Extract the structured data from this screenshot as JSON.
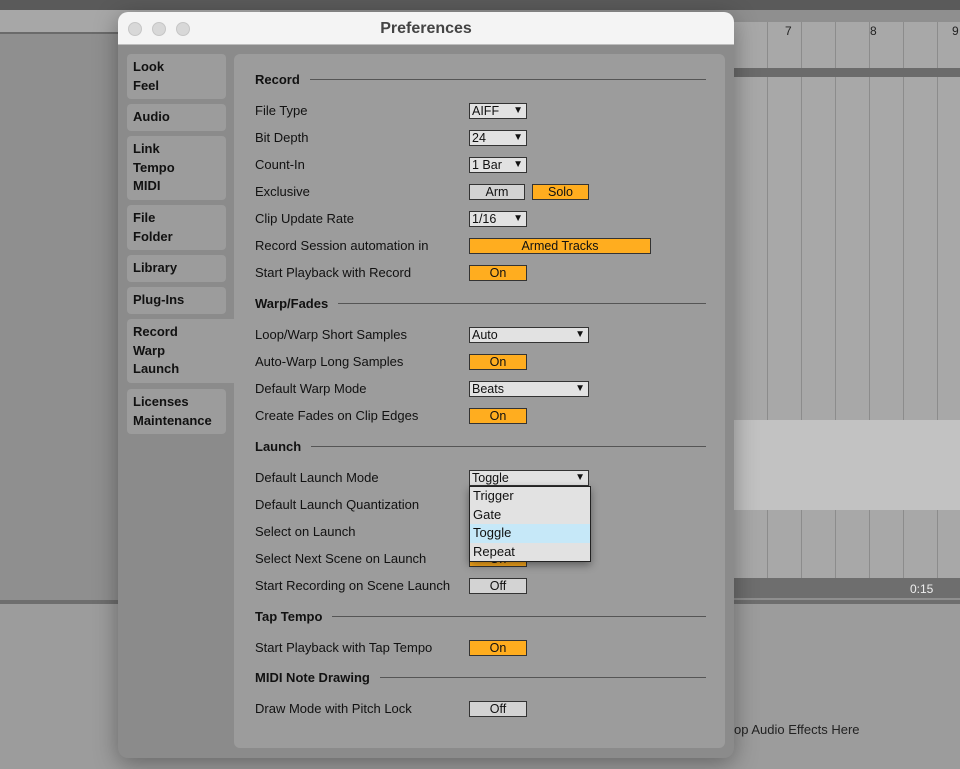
{
  "window": {
    "title": "Preferences"
  },
  "background": {
    "ruler": [
      "7",
      "8",
      "9"
    ],
    "time": "0:15",
    "drop_hint": "op Audio Effects Here"
  },
  "sidebar": {
    "tabs": [
      {
        "lines": [
          "Look",
          "Feel"
        ]
      },
      {
        "lines": [
          "Audio"
        ]
      },
      {
        "lines": [
          "Link",
          "Tempo",
          "MIDI"
        ]
      },
      {
        "lines": [
          "File",
          "Folder"
        ]
      },
      {
        "lines": [
          "Library"
        ]
      },
      {
        "lines": [
          "Plug-Ins"
        ]
      },
      {
        "lines": [
          "Record",
          "Warp",
          "Launch"
        ],
        "active": true
      },
      {
        "lines": [
          "Licenses",
          "Maintenance"
        ]
      }
    ]
  },
  "sections": [
    {
      "title": "Record",
      "rows": [
        {
          "label": "File Type",
          "type": "dropdown",
          "value": "AIFF"
        },
        {
          "label": "Bit Depth",
          "type": "dropdown",
          "value": "24"
        },
        {
          "label": "Count-In",
          "type": "dropdown",
          "value": "1 Bar"
        },
        {
          "label": "Exclusive",
          "type": "pair",
          "options": [
            {
              "label": "Arm",
              "on": false
            },
            {
              "label": "Solo",
              "on": true
            }
          ]
        },
        {
          "label": "Clip Update Rate",
          "type": "dropdown",
          "value": "1/16"
        },
        {
          "label": "Record Session automation in",
          "type": "wide-toggle",
          "value": "Armed Tracks",
          "on": true
        },
        {
          "label": "Start Playback with Record",
          "type": "toggle",
          "value": "On",
          "on": true
        }
      ]
    },
    {
      "title": "Warp/Fades",
      "rows": [
        {
          "label": "Loop/Warp Short Samples",
          "type": "wide-dropdown",
          "value": "Auto"
        },
        {
          "label": "Auto-Warp Long Samples",
          "type": "toggle",
          "value": "On",
          "on": true
        },
        {
          "label": "Default Warp Mode",
          "type": "wide-dropdown",
          "value": "Beats"
        },
        {
          "label": "Create Fades on Clip Edges",
          "type": "toggle",
          "value": "On",
          "on": true
        }
      ]
    },
    {
      "title": "Launch",
      "rows": [
        {
          "label": "Default Launch Mode",
          "type": "wide-dropdown",
          "value": "Toggle"
        },
        {
          "label": "Default Launch Quantization",
          "type": "none"
        },
        {
          "label": "Select on Launch",
          "type": "none"
        },
        {
          "label": "Select Next Scene on Launch",
          "type": "toggle",
          "value": "On",
          "on": true
        },
        {
          "label": "Start Recording on Scene Launch",
          "type": "toggle",
          "value": "Off",
          "on": false
        }
      ]
    },
    {
      "title": "Tap Tempo",
      "rows": [
        {
          "label": "Start Playback with Tap Tempo",
          "type": "toggle",
          "value": "On",
          "on": true
        }
      ]
    },
    {
      "title": "MIDI Note Drawing",
      "rows": [
        {
          "label": "Draw Mode with Pitch Lock",
          "type": "toggle",
          "value": "Off",
          "on": false
        }
      ]
    }
  ],
  "launch_mode_menu": {
    "options": [
      "Trigger",
      "Gate",
      "Toggle",
      "Repeat"
    ],
    "selected": "Toggle"
  },
  "colors": {
    "accent_on": "#ffad1f",
    "menu_highlight": "#c6e8f8"
  }
}
